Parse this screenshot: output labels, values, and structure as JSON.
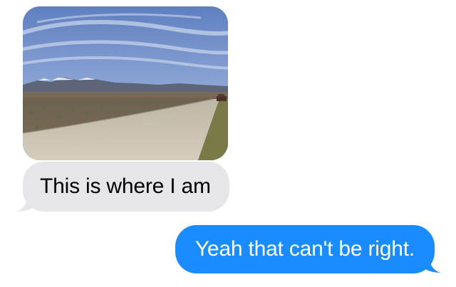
{
  "conversation": {
    "messages": [
      {
        "direction": "received",
        "kind": "photo",
        "image": "road-landscape-photo"
      },
      {
        "direction": "received",
        "kind": "text",
        "text": "This is where I am"
      },
      {
        "direction": "sent",
        "kind": "text",
        "text": "Yeah that can't be right."
      }
    ]
  },
  "colors": {
    "received_bubble": "#e5e5ea",
    "sent_bubble": "#1a8cff",
    "sent_text": "#ffffff",
    "received_text": "#000000"
  }
}
